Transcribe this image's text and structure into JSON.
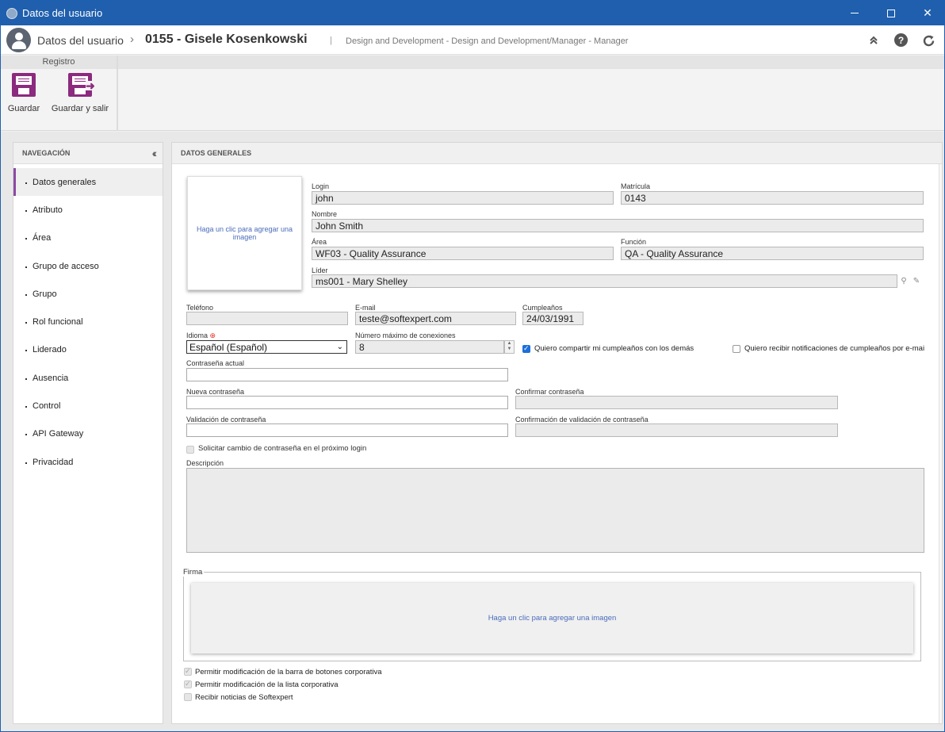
{
  "window": {
    "title": "Datos del usuario"
  },
  "header": {
    "crumb_root": "Datos del usuario",
    "crumb_sep": "›",
    "crumb_record": "0155 - Gisele Kosenkowski",
    "divider": "|",
    "crumb_detail": "Design and Development - Design and Development/Manager - Manager"
  },
  "toolbar": {
    "group_title": "Registro",
    "save_label": "Guardar",
    "save_exit_label": "Guardar y salir"
  },
  "nav": {
    "title": "NAVEGACIÓN",
    "items": [
      {
        "label": "Datos generales",
        "active": true
      },
      {
        "label": "Atributo"
      },
      {
        "label": "Área"
      },
      {
        "label": "Grupo de acceso"
      },
      {
        "label": "Grupo"
      },
      {
        "label": "Rol funcional"
      },
      {
        "label": "Liderado"
      },
      {
        "label": "Ausencia"
      },
      {
        "label": "Control"
      },
      {
        "label": "API Gateway"
      },
      {
        "label": "Privacidad"
      }
    ]
  },
  "main": {
    "title": "DATOS GENERALES",
    "photo_placeholder": "Haga un clic para agregar una imagen",
    "fields": {
      "login": {
        "label": "Login",
        "value": "john"
      },
      "matricula": {
        "label": "Matrícula",
        "value": "0143"
      },
      "nombre": {
        "label": "Nombre",
        "value": "John Smith"
      },
      "area": {
        "label": "Área",
        "value": "WF03 - Quality Assurance"
      },
      "funcion": {
        "label": "Función",
        "value": "QA - Quality Assurance"
      },
      "lider": {
        "label": "Líder",
        "value": "ms001 - Mary Shelley"
      },
      "telefono": {
        "label": "Teléfono",
        "value": ""
      },
      "email": {
        "label": "E-mail",
        "value": "teste@softexpert.com"
      },
      "cumpleanos": {
        "label": "Cumpleaños",
        "value": "24/03/1991"
      },
      "idioma": {
        "label": "Idioma",
        "value": "Español (Español)"
      },
      "max_conexiones": {
        "label": "Número máximo de conexiones",
        "value": "8"
      },
      "contrasena_actual": {
        "label": "Contraseña actual",
        "value": ""
      },
      "nueva_contrasena": {
        "label": "Nueva contraseña",
        "value": ""
      },
      "confirmar_contrasena": {
        "label": "Confirmar contraseña",
        "value": ""
      },
      "validacion_contrasena": {
        "label": "Validación de contraseña",
        "value": ""
      },
      "confirmacion_validacion": {
        "label": "Confirmación de validación de contraseña",
        "value": ""
      },
      "descripcion": {
        "label": "Descripción",
        "value": ""
      }
    },
    "checkboxes": {
      "share_birthday": {
        "label": "Quiero compartir mi cumpleaños con los demás",
        "checked": true
      },
      "birthday_notifications": {
        "label": "Quiero recibir notificaciones de cumpleaños por e-mai",
        "checked": false
      },
      "request_password_change": {
        "label": "Solicitar cambio de contraseña en el próximo login",
        "checked": false
      },
      "allow_toolbar_mod": {
        "label": "Permitir modificación de la barra de botones corporativa",
        "checked": true
      },
      "allow_list_mod": {
        "label": "Permitir modificación de la lista corporativa",
        "checked": true
      },
      "receive_news": {
        "label": "Recibir noticias de Softexpert",
        "checked": false
      }
    },
    "signature": {
      "legend": "Firma",
      "placeholder": "Haga un clic para agregar una imagen"
    }
  },
  "colors": {
    "titlebar": "#1f5fad",
    "accent": "#8b2a7e",
    "active_nav": "#8b4aa0",
    "link": "#4a6cba"
  }
}
